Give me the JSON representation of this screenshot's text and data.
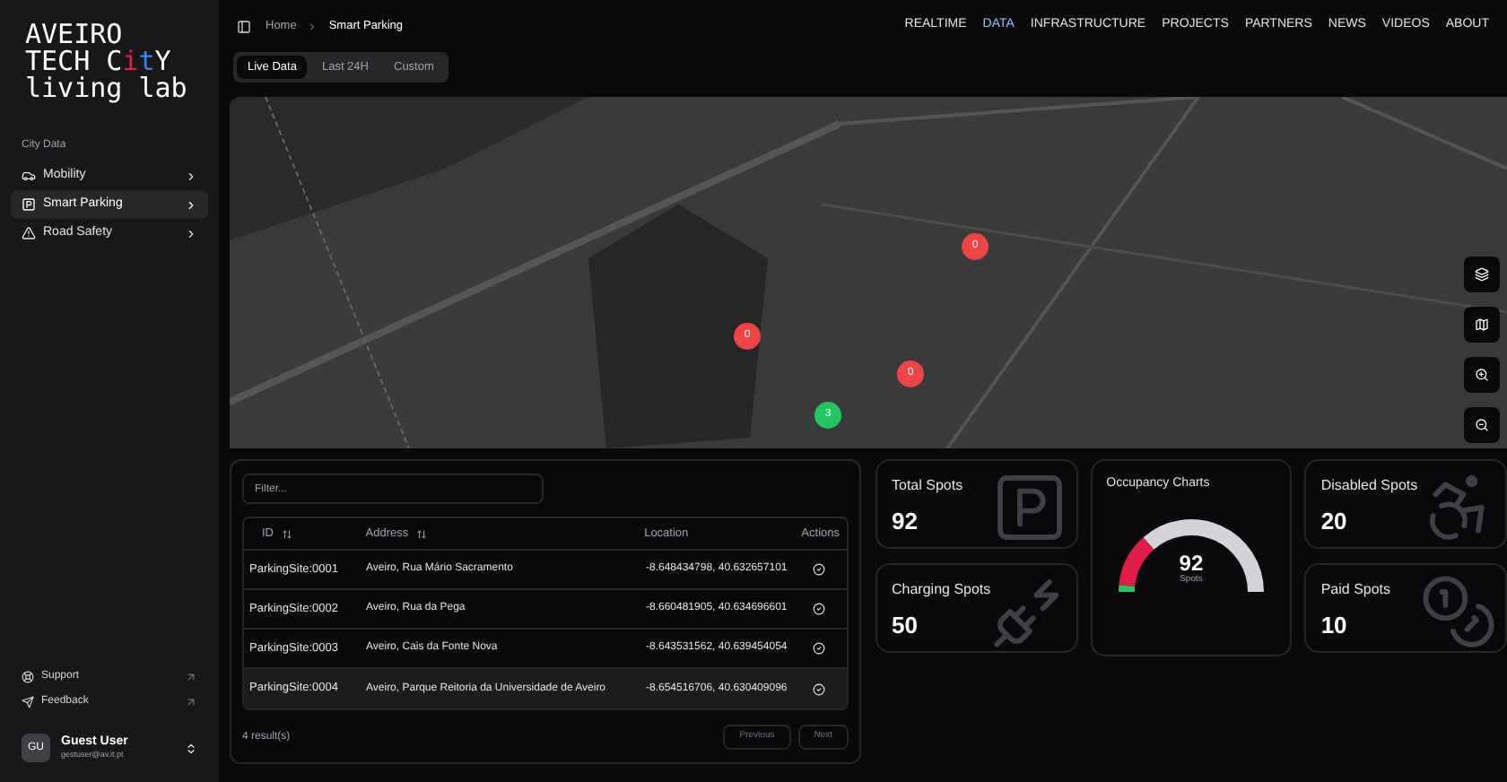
{
  "logo": {
    "line1": "AVEIRO",
    "line2": [
      {
        "text": "TECH C"
      },
      {
        "text": "i",
        "color": "#e11d48"
      },
      {
        "text": "t",
        "color": "#3b82f6"
      },
      {
        "text": "Y"
      }
    ],
    "line3": "living lab"
  },
  "sidebar": {
    "section": "City Data",
    "items": [
      {
        "label": "Mobility",
        "selected": false
      },
      {
        "label": "Smart Parking",
        "selected": true
      },
      {
        "label": "Road Safety",
        "selected": false
      }
    ],
    "footer_links": [
      {
        "label": "Support"
      },
      {
        "label": "Feedback"
      }
    ],
    "user": {
      "initials": "GU",
      "name": "Guest User",
      "email": "gestuser@av.it.pt"
    }
  },
  "breadcrumb": [
    "Home",
    "Smart Parking"
  ],
  "nav": [
    {
      "label": "REALTIME",
      "selected": false
    },
    {
      "label": "DATA",
      "selected": true
    },
    {
      "label": "INFRASTRUCTURE",
      "selected": false
    },
    {
      "label": "PROJECTS",
      "selected": false
    },
    {
      "label": "PARTNERS",
      "selected": false
    },
    {
      "label": "NEWS",
      "selected": false
    },
    {
      "label": "VIDEOS",
      "selected": false
    },
    {
      "label": "ABOUT",
      "selected": false
    }
  ],
  "tabs": [
    {
      "label": "Live Data",
      "selected": true
    },
    {
      "label": "Last 24H",
      "selected": false
    },
    {
      "label": "Custom",
      "selected": false
    }
  ],
  "map": {
    "markers": [
      {
        "count": "0",
        "color": "#ef4444"
      },
      {
        "count": "0",
        "color": "#ef4444"
      },
      {
        "count": "0",
        "color": "#ef4444"
      },
      {
        "count": "3",
        "color": "#22c55e"
      }
    ]
  },
  "table": {
    "filter": {
      "placeholder": "Filter..."
    },
    "columns": [
      {
        "label": "ID",
        "sortable": true
      },
      {
        "label": "Address",
        "sortable": true
      },
      {
        "label": "Location",
        "sortable": false
      },
      {
        "label": "Actions",
        "sortable": false
      }
    ],
    "rows": [
      {
        "id": "ParkingSite:0001",
        "address": "Aveiro, Rua Mário Sacramento",
        "location": "-8.648434798, 40.632657101",
        "selected": false
      },
      {
        "id": "ParkingSite:0002",
        "address": "Aveiro, Rua da Pega",
        "location": "-8.660481905, 40.634696601",
        "selected": false
      },
      {
        "id": "ParkingSite:0003",
        "address": "Aveiro, Cais da Fonte Nova",
        "location": "-8.643531562, 40.639454054",
        "selected": false
      },
      {
        "id": "ParkingSite:0004",
        "address": "Aveiro, Parque Reitoria da Universidade de Aveiro",
        "location": "-8.654516706, 40.630409096",
        "selected": true
      }
    ],
    "results": "4 result(s)",
    "pager": [
      {
        "label": "Previous",
        "disabled": true
      },
      {
        "label": "Next",
        "disabled": true
      }
    ]
  },
  "stats": [
    {
      "label": "Total Spots",
      "value": "92"
    },
    {
      "label": "Charging Spots",
      "value": "50"
    },
    {
      "label": "Disabled Spots",
      "value": "20"
    },
    {
      "label": "Paid Spots",
      "value": "10"
    }
  ],
  "occupancy": {
    "title": "Occupancy Charts",
    "value": "92",
    "unit": "Spots"
  }
}
